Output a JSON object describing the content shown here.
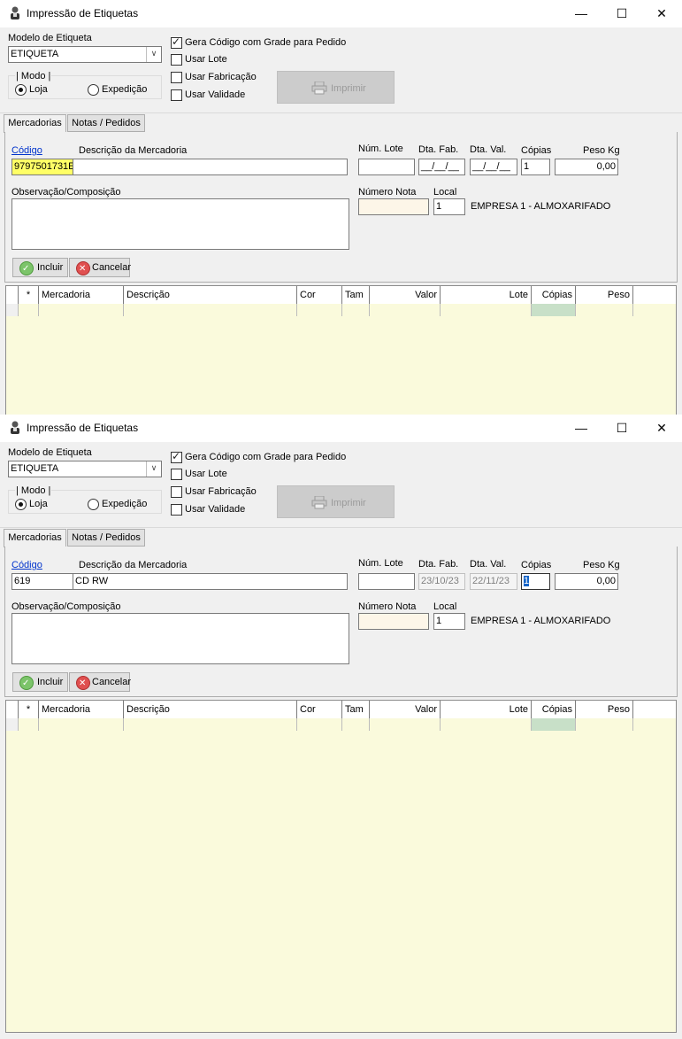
{
  "windows": [
    {
      "title": "Impressão de Etiquetas",
      "modelo_label": "Modelo de Etiqueta",
      "modelo_value": "ETIQUETA",
      "modo_label": "Modo",
      "modo_loja": "Loja",
      "modo_expedicao": "Expedição",
      "gera_codigo": "Gera Código com Grade para Pedido",
      "usar_lote": "Usar Lote",
      "usar_fabricacao": "Usar Fabricação",
      "usar_validade": "Usar Validade",
      "imprimir": "Imprimir",
      "tab_mercadorias": "Mercadorias",
      "tab_notas": "Notas / Pedidos",
      "codigo_label": "Código",
      "descricao_label": "Descrição da Mercadoria",
      "codigo_value": "9797501731E",
      "descricao_value": "",
      "num_lote_label": "Núm. Lote",
      "dta_fab_label": "Dta. Fab.",
      "dta_val_label": "Dta. Val.",
      "copias_label": "Cópias",
      "peso_label": "Peso Kg",
      "num_lote_value": "",
      "dta_fab_value": "__/__/__",
      "dta_val_value": "__/__/__",
      "copias_value": "1",
      "peso_value": "0,00",
      "obs_label": "Observação/Composição",
      "numero_nota_label": "Número Nota",
      "local_label": "Local",
      "local_value": "1",
      "local_desc": "EMPRESA 1 - ALMOXARIFADO",
      "incluir": "Incluir",
      "cancelar": "Cancelar",
      "columns": [
        "*",
        "Mercadoria",
        "Descrição",
        "Cor",
        "Tam",
        "Valor",
        "Lote",
        "Cópias",
        "Peso"
      ]
    },
    {
      "title": "Impressão de Etiquetas",
      "modelo_label": "Modelo de Etiqueta",
      "modelo_value": "ETIQUETA",
      "modo_label": "Modo",
      "modo_loja": "Loja",
      "modo_expedicao": "Expedição",
      "gera_codigo": "Gera Código com Grade para Pedido",
      "usar_lote": "Usar Lote",
      "usar_fabricacao": "Usar Fabricação",
      "usar_validade": "Usar Validade",
      "imprimir": "Imprimir",
      "tab_mercadorias": "Mercadorias",
      "tab_notas": "Notas / Pedidos",
      "codigo_label": "Código",
      "descricao_label": "Descrição da Mercadoria",
      "codigo_value": "619",
      "descricao_value": "CD RW",
      "num_lote_label": "Núm. Lote",
      "dta_fab_label": "Dta. Fab.",
      "dta_val_label": "Dta. Val.",
      "copias_label": "Cópias",
      "peso_label": "Peso Kg",
      "num_lote_value": "",
      "dta_fab_value": "23/10/23",
      "dta_val_value": "22/11/23",
      "copias_value": "1",
      "peso_value": "0,00",
      "obs_label": "Observação/Composição",
      "numero_nota_label": "Número Nota",
      "local_label": "Local",
      "local_value": "1",
      "local_desc": "EMPRESA 1 - ALMOXARIFADO",
      "incluir": "Incluir",
      "cancelar": "Cancelar",
      "columns": [
        "*",
        "Mercadoria",
        "Descrição",
        "Cor",
        "Tam",
        "Valor",
        "Lote",
        "Cópias",
        "Peso"
      ]
    }
  ],
  "icons": {
    "app": "person-icon",
    "minimize": "minimize-icon",
    "maximize": "maximize-icon",
    "close": "close-icon",
    "printer": "printer-icon",
    "incluir": "check-circle-icon",
    "cancelar": "cancel-circle-icon"
  },
  "colors": {
    "grid_background": "#fafadc",
    "highlight_input": "#ffff66",
    "nota_input": "#fdf6e8",
    "copias_column": "#c8e0c8"
  }
}
